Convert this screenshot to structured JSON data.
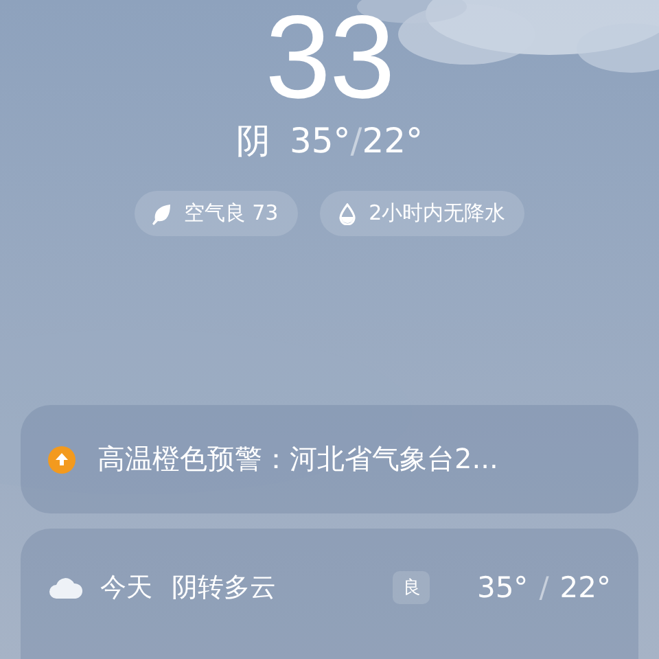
{
  "current": {
    "temperature": "33",
    "condition": "阴",
    "high": "35°",
    "separator": "/",
    "low": "22°"
  },
  "chips": [
    {
      "kind": "air",
      "label": "空气良 73"
    },
    {
      "kind": "rain",
      "label": "2小时内无降水"
    }
  ],
  "alert": {
    "text": "高温橙色预警：河北省气象台2..."
  },
  "forecast": [
    {
      "day": "今天",
      "condition": "阴转多云",
      "air": "良",
      "high": "35°",
      "separator": "/",
      "low": "22°"
    }
  ]
}
